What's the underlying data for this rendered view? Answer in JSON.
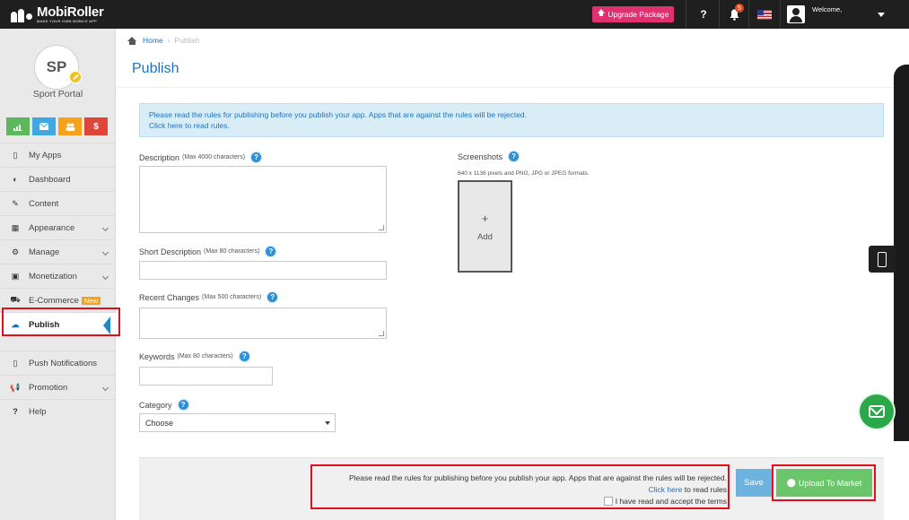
{
  "header": {
    "logo_name": "MobiRoller",
    "logo_tagline": "MAKE YOUR OWN MOBILE APP",
    "upgrade_label": "Upgrade Package",
    "help_label": "?",
    "notification_count": "5",
    "welcome_label": "Welcome,"
  },
  "sidebar": {
    "avatar_initials": "SP",
    "app_name": "Sport Portal",
    "quick_buttons": [
      {
        "icon": "bar-chart-icon",
        "color": "#5cb85c"
      },
      {
        "icon": "mail-icon",
        "color": "#3fa8e0"
      },
      {
        "icon": "users-icon",
        "color": "#f7a21b"
      },
      {
        "icon": "dollar-icon",
        "color": "#e0453a",
        "label": "$"
      }
    ],
    "items": [
      {
        "label": "My Apps"
      },
      {
        "label": "Dashboard"
      },
      {
        "label": "Content"
      },
      {
        "label": "Appearance"
      },
      {
        "label": "Manage"
      },
      {
        "label": "Monetization"
      },
      {
        "label": "E-Commerce",
        "badge": "New"
      },
      {
        "label": "Publish"
      },
      {
        "label": "Push Notifications"
      },
      {
        "label": "Promotion"
      },
      {
        "label": "Help"
      }
    ]
  },
  "breadcrumb": {
    "home": "Home",
    "current": "Publish"
  },
  "page": {
    "title": "Publish",
    "alert_line1": "Please read the rules for publishing before you publish your app. Apps that are against the rules will be rejected.",
    "alert_line2": "Click here to read rules."
  },
  "form": {
    "description_label": "Description",
    "description_hint": "(Max 4000 characters)",
    "short_description_label": "Short Description",
    "short_description_hint": "(Max 80 characters)",
    "recent_changes_label": "Recent Changes",
    "recent_changes_hint": "(Max 500 characters)",
    "keywords_label": "Keywords",
    "keywords_hint": "(Max 80 characters)",
    "category_label": "Category",
    "category_value": "Choose",
    "screenshots_label": "Screenshots",
    "screenshots_hint": "640 x 1136 pixels and PNG, JPG or JPEG formats.",
    "add_label": "Add"
  },
  "footer": {
    "rules_text": "Please read the rules for publishing before you publish your app. Apps that are against the rules will be rejected.",
    "click_here": "Click here",
    "to_read_rules": "to read rules",
    "accept_terms": "I have read and accept the terms",
    "save_label": "Save",
    "upload_label": "Upload To Market"
  },
  "colors": {
    "accent": "#1e73be",
    "highlight": "#e10f1a",
    "upload": "#6ac56b",
    "topbar": "#1f1f1f"
  }
}
